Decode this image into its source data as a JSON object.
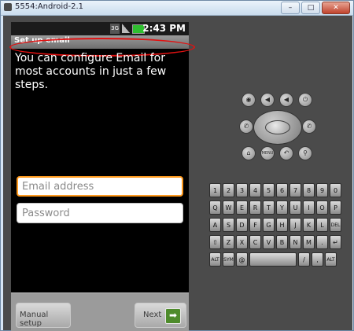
{
  "window": {
    "title": "5554:Android-2.1",
    "minimize": "–",
    "maximize": "□",
    "close": "✕"
  },
  "status_bar": {
    "network": "3G",
    "time": "2:43 PM"
  },
  "app": {
    "title": "Set up email",
    "intro": "You can configure Email for most accounts in just a few steps.",
    "email_placeholder": "Email address",
    "password_placeholder": "Password",
    "manual_setup_label": "Manual setup",
    "next_label": "Next",
    "next_icon": "right-arrow-icon"
  },
  "controls": {
    "camera": "◉",
    "vol_down": "◀",
    "vol_up": "◀",
    "power": "⏻",
    "call": "✆",
    "end_call": "✆",
    "home": "⌂",
    "menu": "MENU",
    "back": "↶",
    "search": "⚲"
  },
  "keyboard": {
    "row1": [
      "1",
      "2",
      "3",
      "4",
      "5",
      "6",
      "7",
      "8",
      "9",
      "0"
    ],
    "row2": [
      "Q",
      "W",
      "E",
      "R",
      "T",
      "Y",
      "U",
      "I",
      "O",
      "P"
    ],
    "row3": [
      "A",
      "S",
      "D",
      "F",
      "G",
      "H",
      "J",
      "K",
      "L",
      "DEL"
    ],
    "row4": [
      "⇧",
      "Z",
      "X",
      "C",
      "V",
      "B",
      "N",
      "M",
      ".",
      "↵"
    ],
    "row5": [
      "ALT",
      "SYM",
      "@",
      "",
      "/",
      ",",
      "ALT"
    ]
  }
}
